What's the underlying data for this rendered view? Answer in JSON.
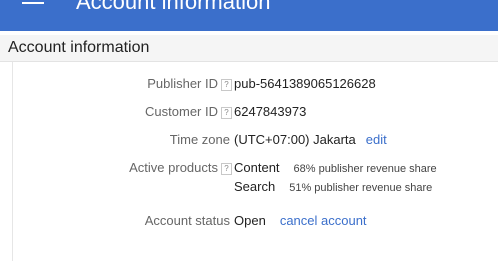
{
  "header": {
    "title": "Account information",
    "menu_icon": "hamburger-menu-icon",
    "color": "#3b6fcb"
  },
  "section": {
    "title": "Account information"
  },
  "rows": {
    "publisher_id": {
      "label": "Publisher ID",
      "help": "?",
      "value": "pub-5641389065126628"
    },
    "customer_id": {
      "label": "Customer ID",
      "help": "?",
      "value": "6247843973"
    },
    "time_zone": {
      "label": "Time zone",
      "value": "(UTC+07:00) Jakarta",
      "action": "edit"
    },
    "active_products": {
      "label": "Active products",
      "help": "?",
      "items": [
        {
          "name": "Content",
          "share": "68% publisher revenue share"
        },
        {
          "name": "Search",
          "share": "51% publisher revenue share"
        }
      ]
    },
    "account_status": {
      "label": "Account status",
      "value": "Open",
      "action": "cancel account"
    }
  },
  "link_color": "#3b6fcb"
}
